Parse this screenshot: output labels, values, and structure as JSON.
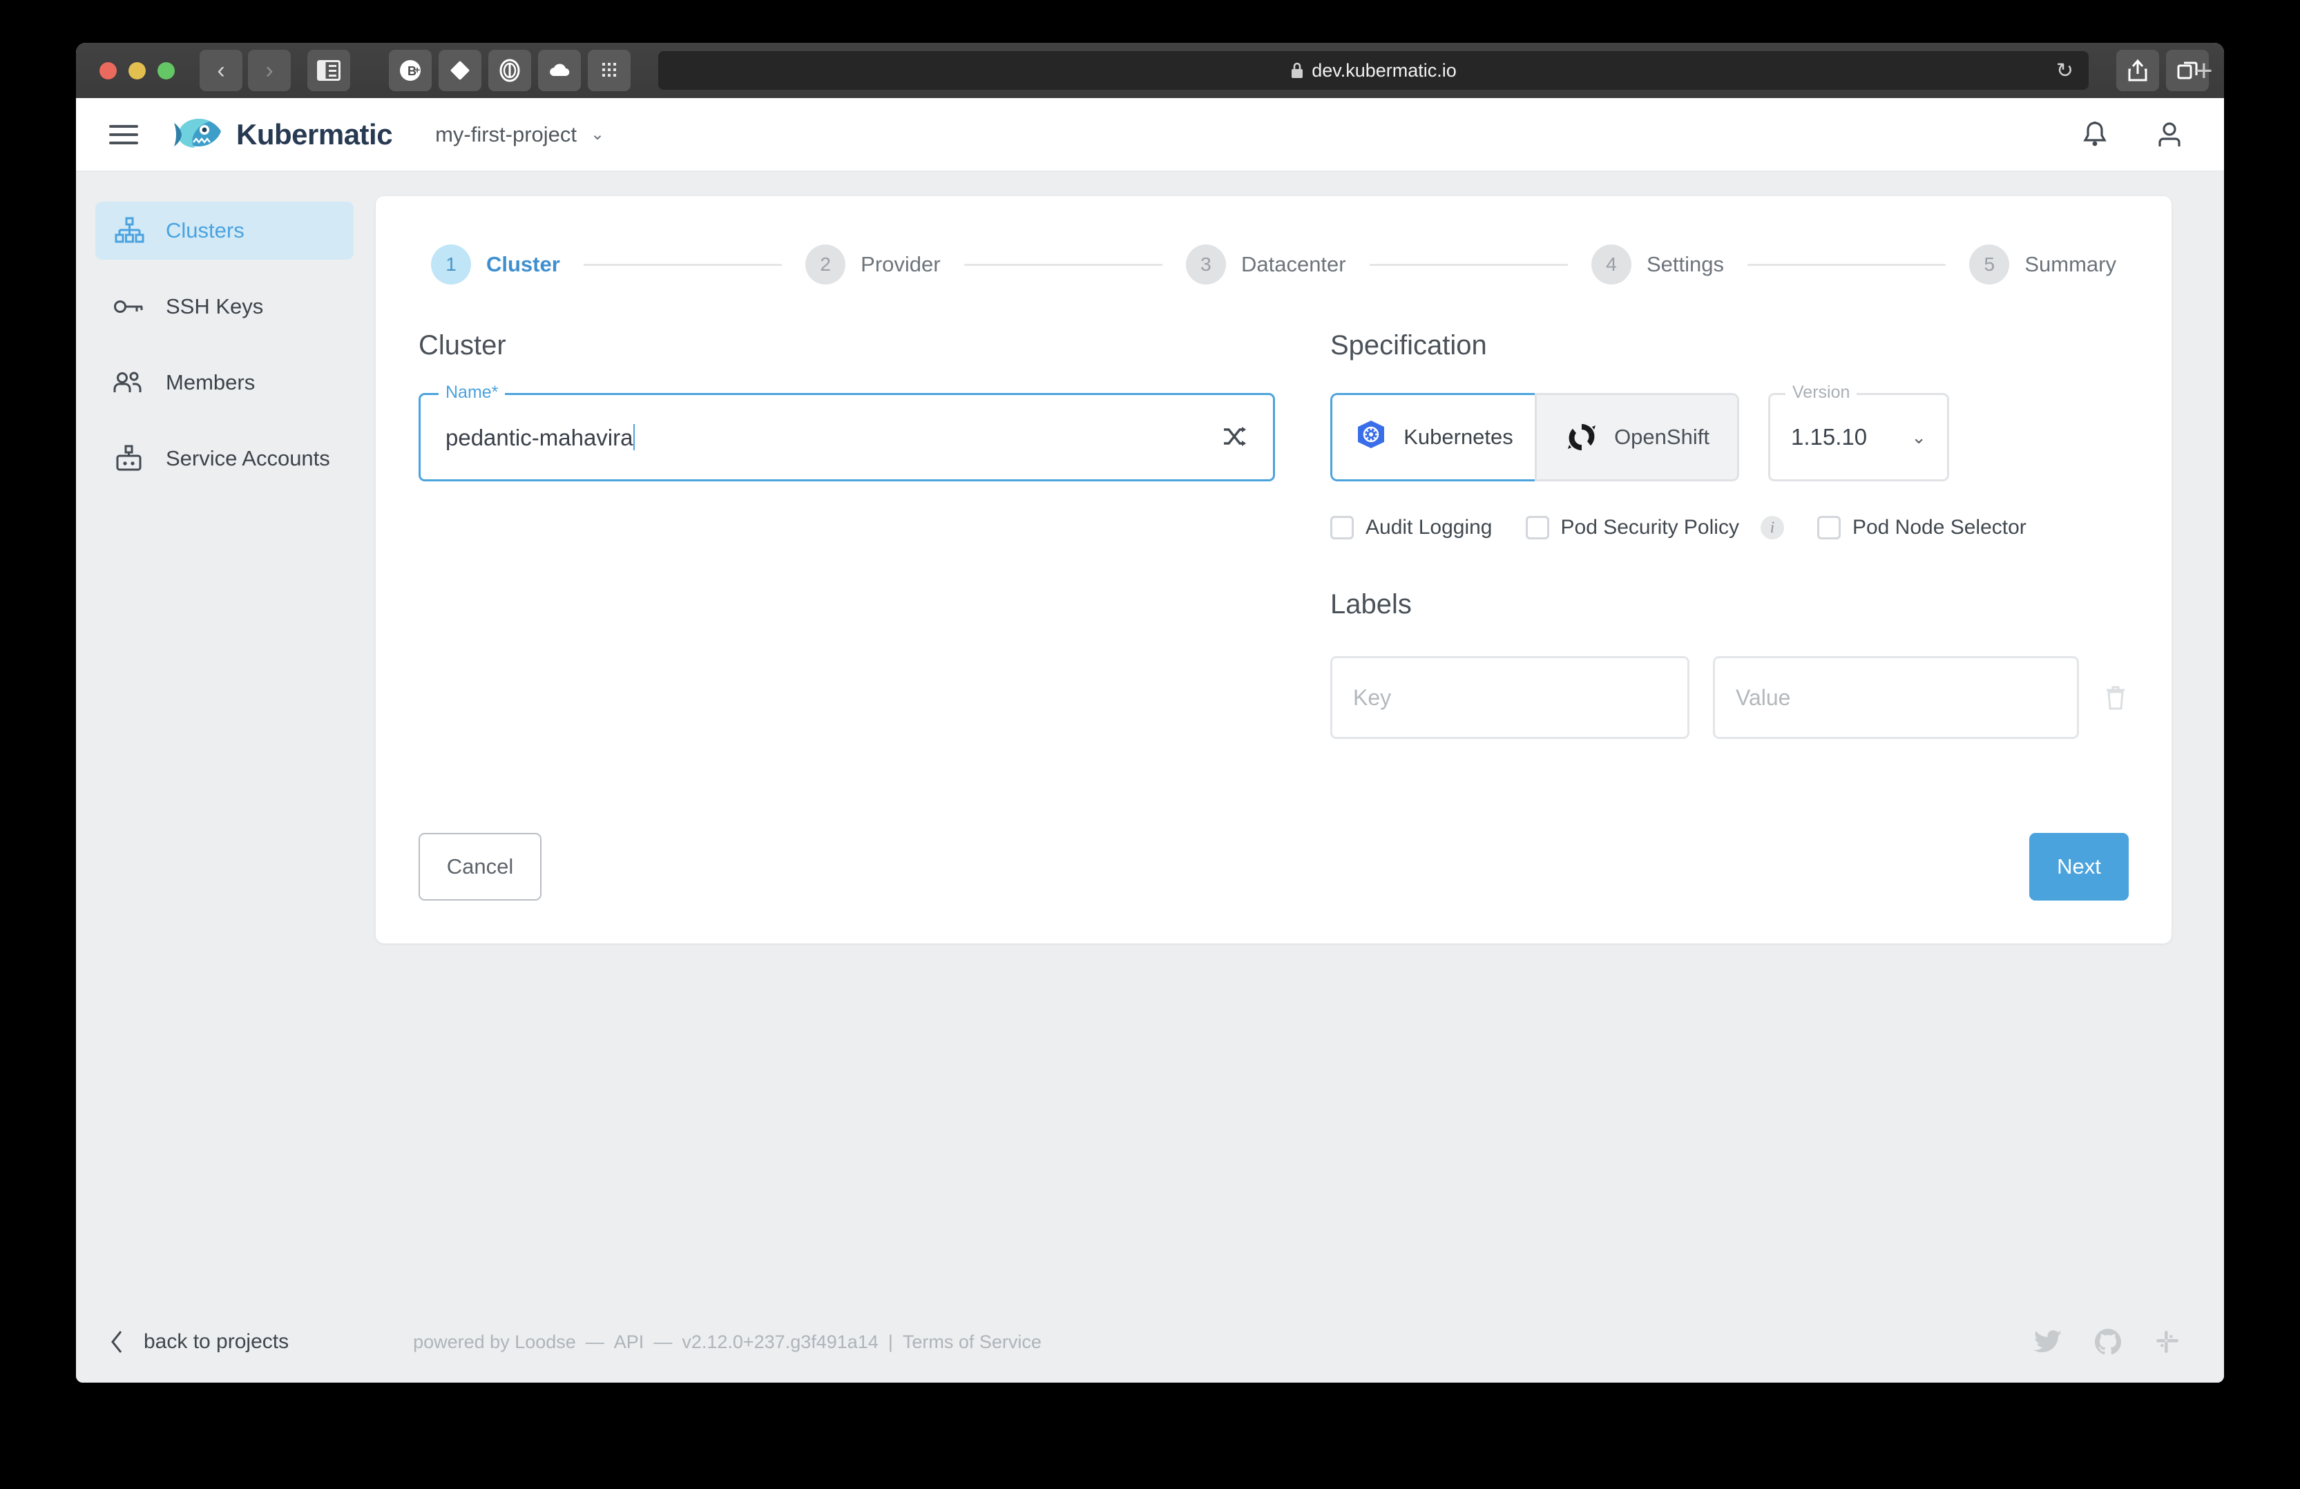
{
  "browser": {
    "url": "dev.kubermatic.io",
    "lock_icon": "lock-icon",
    "reload_icon": "reload-icon",
    "back_icon": "back-arrow-icon",
    "forward_icon": "forward-arrow-icon",
    "sidebar_icon": "sidebar-toggle-icon",
    "share_icon": "share-icon",
    "tabs_icon": "tab-overview-icon",
    "newtab_label": "+",
    "extensions": [
      "bitwarden-icon",
      "adblock-hand-icon",
      "ghostery-icon",
      "cloud-icon",
      "apps-grid-icon"
    ]
  },
  "topbar": {
    "menu_icon": "hamburger-menu-icon",
    "logo_icon": "kubermatic-fish-logo",
    "brand": "Kubermatic",
    "project": "my-first-project",
    "project_chevron": "chevron-down-icon",
    "notifications_icon": "bell-icon",
    "user_icon": "user-account-icon"
  },
  "sidebar": {
    "items": [
      {
        "label": "Clusters",
        "icon": "clusters-icon",
        "active": true
      },
      {
        "label": "SSH Keys",
        "icon": "key-icon",
        "active": false
      },
      {
        "label": "Members",
        "icon": "members-icon",
        "active": false
      },
      {
        "label": "Service Accounts",
        "icon": "service-account-robot-icon",
        "active": false
      }
    ]
  },
  "wizard": {
    "steps": [
      {
        "num": "1",
        "label": "Cluster"
      },
      {
        "num": "2",
        "label": "Provider"
      },
      {
        "num": "3",
        "label": "Datacenter"
      },
      {
        "num": "4",
        "label": "Settings"
      },
      {
        "num": "5",
        "label": "Summary"
      }
    ],
    "cluster": {
      "heading": "Cluster",
      "name_label": "Name*",
      "name_value": "pedantic-mahavira",
      "randomize_icon": "shuffle-icon"
    },
    "specification": {
      "heading": "Specification",
      "providers": [
        {
          "label": "Kubernetes",
          "icon": "kubernetes-logo",
          "selected": true
        },
        {
          "label": "OpenShift",
          "icon": "openshift-logo",
          "selected": false
        }
      ],
      "version_label": "Version",
      "version_value": "1.15.10",
      "version_chevron": "chevron-down-icon",
      "checkboxes": [
        {
          "label": "Audit Logging",
          "checked": false,
          "info": false
        },
        {
          "label": "Pod Security Policy",
          "checked": false,
          "info": true
        },
        {
          "label": "Pod Node Selector",
          "checked": false,
          "info": false
        }
      ],
      "info_badge_text": "i"
    },
    "labels": {
      "heading": "Labels",
      "key_placeholder": "Key",
      "value_placeholder": "Value",
      "delete_icon": "trash-icon"
    },
    "cancel_label": "Cancel",
    "next_label": "Next"
  },
  "footer": {
    "back_icon": "chevron-left-icon",
    "back_label": "back to projects",
    "powered_by": "powered by Loodse",
    "sep1": "—",
    "api_label": "API",
    "sep2": "—",
    "version": "v2.12.0+237.g3f491a14",
    "divider": "|",
    "terms": "Terms of Service",
    "social": [
      "twitter-icon",
      "github-icon",
      "slack-icon"
    ]
  },
  "colors": {
    "accent": "#4ba3dd",
    "accent_soft": "#bfe5f7",
    "sidebar_active_bg": "#d3e9f6",
    "page_bg": "#eceef0",
    "text": "#3d434a"
  }
}
